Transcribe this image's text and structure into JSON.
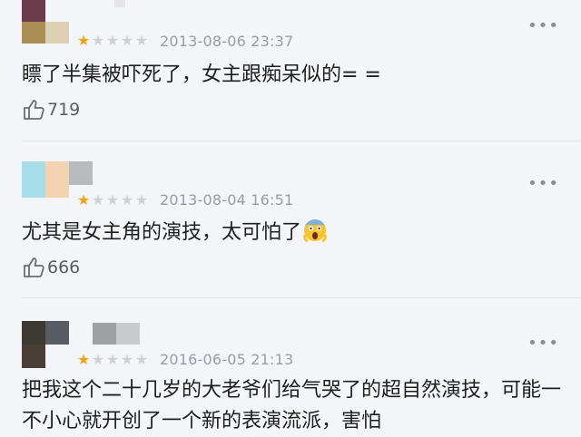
{
  "reviews": [
    {
      "stars": 1,
      "stars_total": 5,
      "date": "2013-08-06 23:37",
      "text": "瞟了半集被吓死了，女主跟痴呆似的= =",
      "likes": "719",
      "more_icon": "more-icon"
    },
    {
      "stars": 1,
      "stars_total": 5,
      "date": "2013-08-04 16:51",
      "text": "尤其是女主角的演技，太可怕了",
      "likes": "666",
      "emoji": "screaming-face-icon",
      "more_icon": "more-icon"
    },
    {
      "stars": 1,
      "stars_total": 5,
      "date": "2016-06-05 21:13",
      "text": "把我这个二十几岁的大老爷们给气哭了的超自然演技，可能一不小心就开创了一个新的表演流派，害怕",
      "more_icon": "more-icon"
    }
  ],
  "colors": {
    "background": "#f4f5f9",
    "star_on": "#f2a21a",
    "star_off": "#cfd1d6",
    "meta_text": "#9a9ca3"
  }
}
